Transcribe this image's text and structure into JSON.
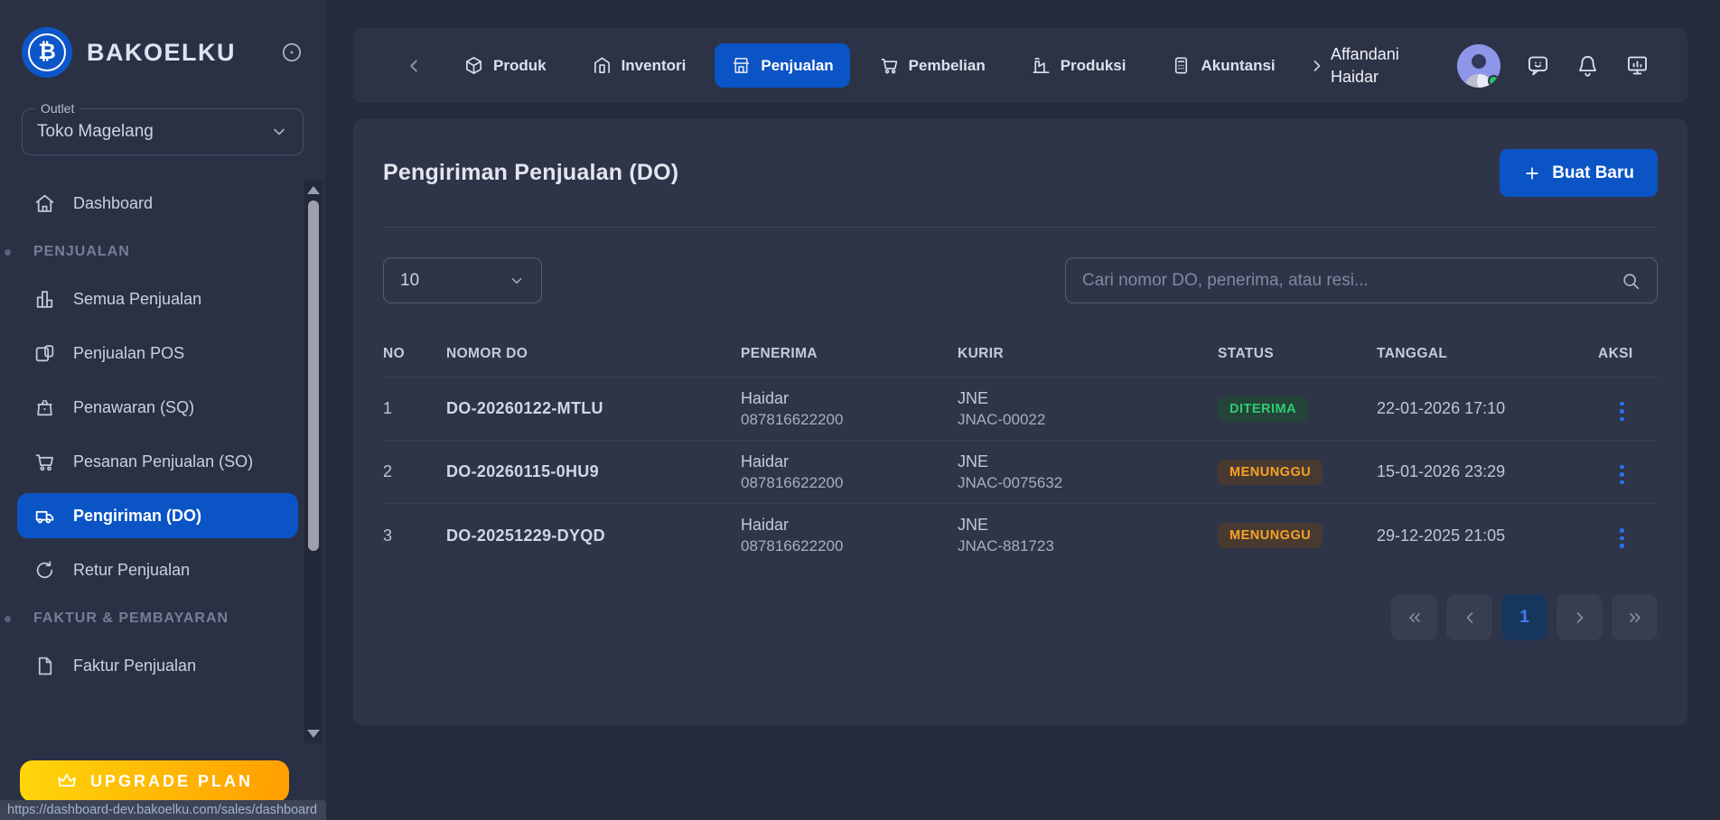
{
  "brand": {
    "name": "BAKOELKU"
  },
  "sidebar": {
    "outlet": {
      "label": "Outlet",
      "value": "Toko Magelang"
    },
    "dashboard": {
      "label": "Dashboard",
      "icon": "home-icon"
    },
    "sections": [
      {
        "label": "PENJUALAN",
        "items": [
          {
            "label": "Semua Penjualan",
            "icon": "bar-chart-icon"
          },
          {
            "label": "Penjualan POS",
            "icon": "pos-icon"
          },
          {
            "label": "Penawaran (SQ)",
            "icon": "basket-icon"
          },
          {
            "label": "Pesanan Penjualan (SO)",
            "icon": "cart-icon"
          },
          {
            "label": "Pengiriman (DO)",
            "icon": "truck-icon",
            "active": true
          },
          {
            "label": "Retur Penjualan",
            "icon": "return-icon"
          }
        ]
      },
      {
        "label": "FAKTUR & PEMBAYARAN",
        "items": [
          {
            "label": "Faktur Penjualan",
            "icon": "document-icon"
          }
        ]
      }
    ],
    "upgrade_label": "UPGRADE PLAN"
  },
  "topnav": {
    "tabs": [
      {
        "label": "Produk",
        "icon": "cube-icon"
      },
      {
        "label": "Inventori",
        "icon": "warehouse-icon"
      },
      {
        "label": "Penjualan",
        "icon": "store-icon",
        "active": true
      },
      {
        "label": "Pembelian",
        "icon": "cart-icon"
      },
      {
        "label": "Produksi",
        "icon": "factory-icon"
      },
      {
        "label": "Akuntansi",
        "icon": "calculator-icon"
      }
    ],
    "user_name": "Affandani Haidar",
    "status_icons": [
      "chat-icon",
      "bell-icon",
      "display-icon"
    ]
  },
  "page": {
    "title": "Pengiriman Penjualan (DO)",
    "create_button_label": "Buat Baru"
  },
  "toolbar": {
    "page_size": "10",
    "search_placeholder": "Cari nomor DO, penerima, atau resi..."
  },
  "table": {
    "columns": [
      "NO",
      "NOMOR DO",
      "PENERIMA",
      "KURIR",
      "STATUS",
      "TANGGAL",
      "AKSI"
    ],
    "rows": [
      {
        "no": "1",
        "nomor_do": "DO-20260122-MTLU",
        "penerima_nama": "Haidar",
        "penerima_telepon": "087816622200",
        "kurir_nama": "JNE",
        "kurir_resi": "JNAC-00022",
        "status": "DITERIMA",
        "status_type": "success",
        "tanggal": "22-01-2026 17:10"
      },
      {
        "no": "2",
        "nomor_do": "DO-20260115-0HU9",
        "penerima_nama": "Haidar",
        "penerima_telepon": "087816622200",
        "kurir_nama": "JNE",
        "kurir_resi": "JNAC-0075632",
        "status": "MENUNGGU",
        "status_type": "pending",
        "tanggal": "15-01-2026 23:29"
      },
      {
        "no": "3",
        "nomor_do": "DO-20251229-DYQD",
        "penerima_nama": "Haidar",
        "penerima_telepon": "087816622200",
        "kurir_nama": "JNE",
        "kurir_resi": "JNAC-881723",
        "status": "MENUNGGU",
        "status_type": "pending",
        "tanggal": "29-12-2025 21:05"
      }
    ]
  },
  "pagination": {
    "current_page": "1"
  },
  "statusbar": {
    "url": "https://dashboard-dev.bakoelku.com/sales/dashboard"
  },
  "colors": {
    "accent_blue": "#0b54c6",
    "status_green": "#2ecc71",
    "status_orange": "#f7a225",
    "upgrade_start": "#ffd60a",
    "upgrade_end": "#ff9e00"
  }
}
